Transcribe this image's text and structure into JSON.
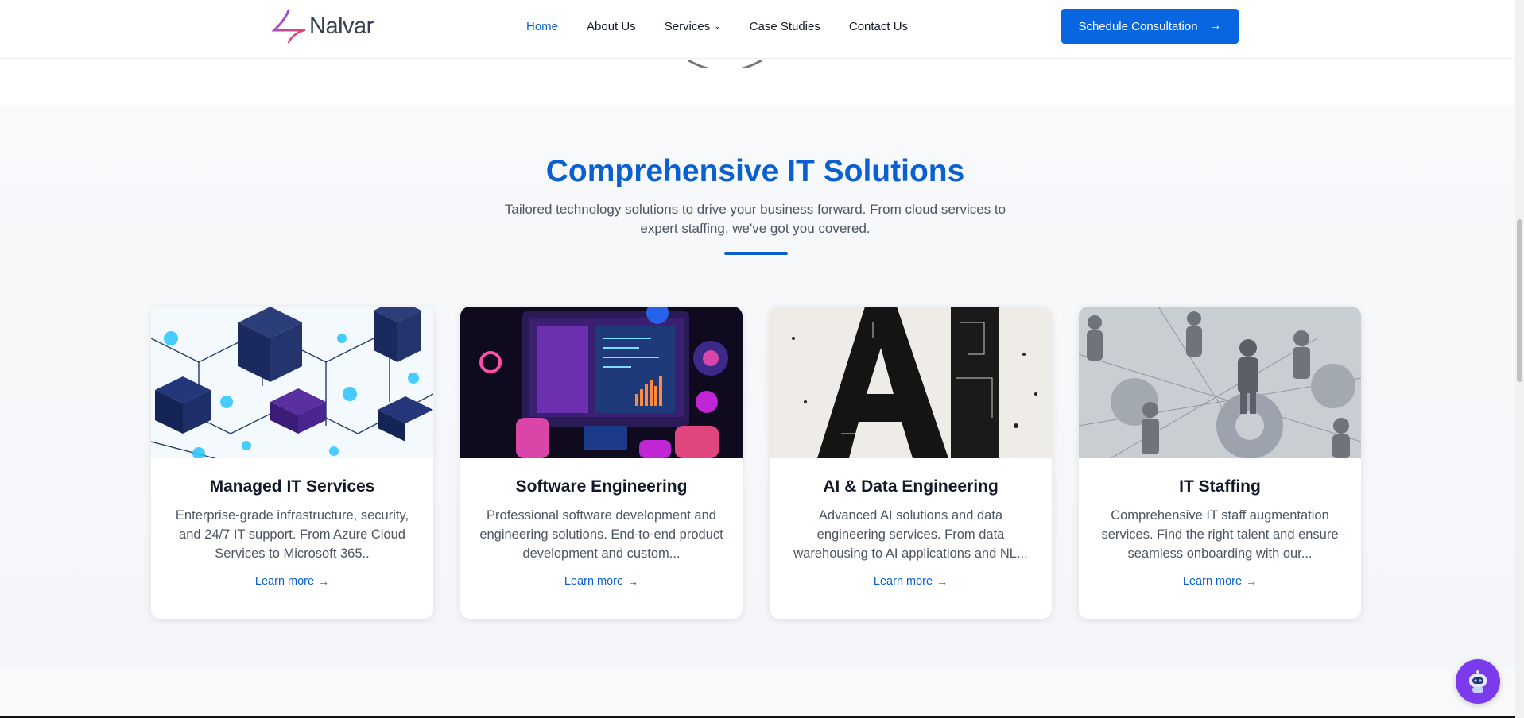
{
  "nav": {
    "brand": "Nalvar",
    "items": [
      {
        "label": "Home",
        "active": true
      },
      {
        "label": "About Us"
      },
      {
        "label": "Services",
        "has_dropdown": true
      },
      {
        "label": "Case Studies"
      },
      {
        "label": "Contact Us"
      }
    ],
    "cta_label": "Schedule Consultation",
    "dropdown_icon": "chevron-down-icon",
    "cta_icon": "arrow-right-icon"
  },
  "section": {
    "title": "Comprehensive IT Solutions",
    "subtitle": "Tailored technology solutions to drive your business forward. From cloud services to expert staffing, we've got you covered."
  },
  "cards": [
    {
      "title": "Managed IT Services",
      "description": "Enterprise-grade infrastructure, security, and 24/7 IT support. From Azure Cloud Services to Microsoft 365..",
      "link": "Learn more",
      "image": "isometric-network-servers-image"
    },
    {
      "title": "Software Engineering",
      "description": "Professional software development and engineering solutions. End-to-end product development and custom...",
      "link": "Learn more",
      "image": "code-monitor-gears-image"
    },
    {
      "title": "AI & Data Engineering",
      "description": "Advanced AI solutions and data engineering services. From data warehousing to AI applications and NL...",
      "link": "Learn more",
      "image": "ai-letters-circuit-image"
    },
    {
      "title": "IT Staffing",
      "description": "Comprehensive IT staff augmentation services. Find the right talent and ensure seamless onboarding with our...",
      "link": "Learn more",
      "image": "people-gears-network-image"
    }
  ],
  "colors": {
    "accent": "#0b5fcf",
    "cta": "#0866e0",
    "chatbot": "#7c3aed"
  }
}
